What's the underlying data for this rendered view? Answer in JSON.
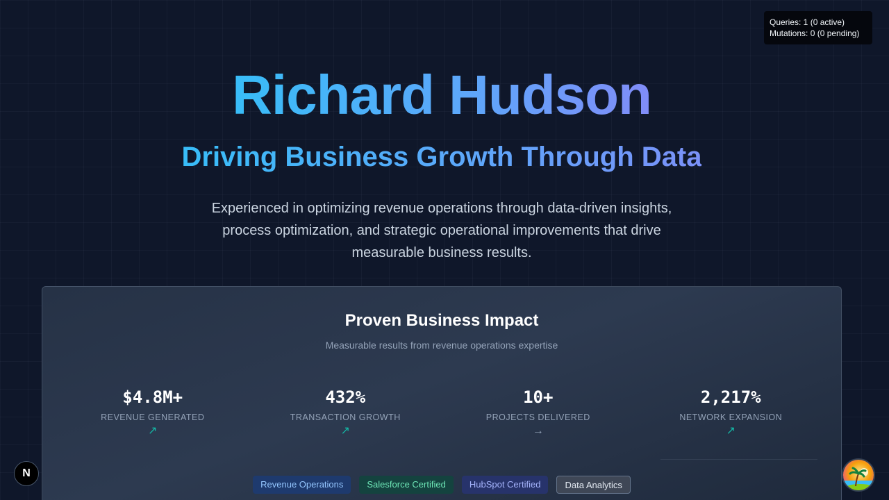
{
  "devtools": {
    "queries": "Queries: 1 (0 active)",
    "mutations": "Mutations: 0 (0 pending)"
  },
  "hero": {
    "name": "Richard Hudson",
    "tagline": "Driving Business Growth Through Data",
    "intro": "Experienced in optimizing revenue operations through data-driven insights, process optimization, and strategic operational improvements that drive measurable business results."
  },
  "impact": {
    "title": "Proven Business Impact",
    "subtitle": "Measurable results from revenue operations expertise",
    "stats": [
      {
        "value": "$4.8M+",
        "label": "REVENUE GENERATED",
        "trend": "↗",
        "trend_icon": "trend-up-icon"
      },
      {
        "value": "432%",
        "label": "TRANSACTION GROWTH",
        "trend": "↗",
        "trend_icon": "trend-up-icon"
      },
      {
        "value": "10+",
        "label": "PROJECTS DELIVERED",
        "trend": "→",
        "trend_icon": "trend-flat-icon"
      },
      {
        "value": "2,217%",
        "label": "NETWORK EXPANSION",
        "trend": "↗",
        "trend_icon": "trend-up-icon"
      }
    ],
    "tags": [
      {
        "label": "Revenue Operations"
      },
      {
        "label": "Salesforce Certified"
      },
      {
        "label": "HubSpot Certified"
      },
      {
        "label": "Data Analytics"
      }
    ]
  },
  "next_badge": {
    "label": "N"
  },
  "colors": {
    "background": "#0f172a",
    "accent_start": "#38bdf8",
    "accent_end": "#818cf8",
    "trend_up": "#14b8a6"
  }
}
